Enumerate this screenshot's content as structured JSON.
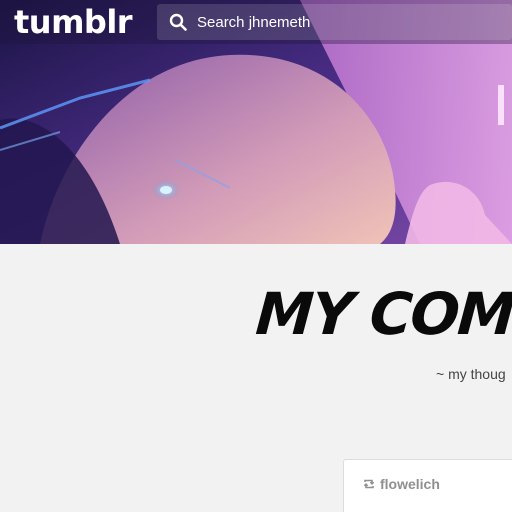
{
  "topbar": {
    "logo_text": "tumblr",
    "search": {
      "placeholder": "Search jhnemeth",
      "icon": "search-icon"
    }
  },
  "blog": {
    "title": "MY COMM",
    "subtitle": "~ my thoug"
  },
  "post": {
    "author": "flowelich",
    "icon": "reblog-icon"
  },
  "colors": {
    "page_background": "#f3f2f3",
    "title_color": "#0a0a0a",
    "subtitle_color": "#444444",
    "author_color": "#8f8f8f"
  }
}
